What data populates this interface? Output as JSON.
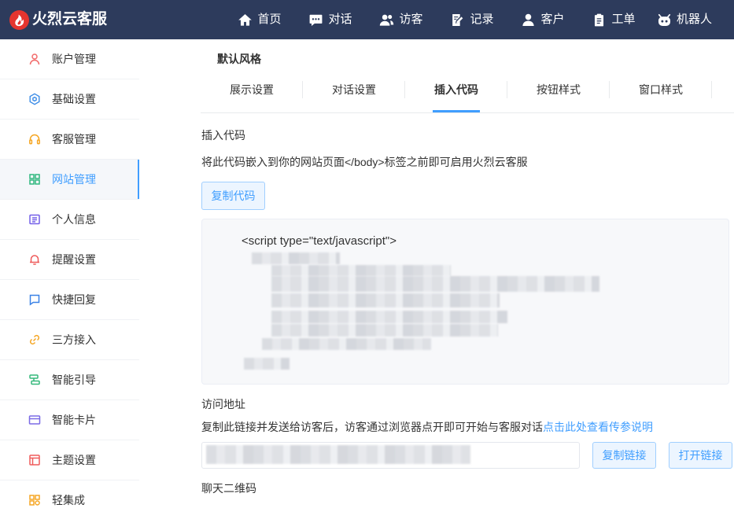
{
  "header": {
    "logo_text": "火烈云客服",
    "logo_icon": "flame-logo-icon",
    "nav": [
      {
        "label": "首页",
        "icon": "home-icon"
      },
      {
        "label": "对话",
        "icon": "chat-icon"
      },
      {
        "label": "访客",
        "icon": "visitors-icon"
      },
      {
        "label": "记录",
        "icon": "record-icon"
      },
      {
        "label": "客户",
        "icon": "customer-icon"
      },
      {
        "label": "工单",
        "icon": "ticket-icon"
      },
      {
        "label": "机器人",
        "icon": "robot-icon"
      }
    ]
  },
  "sidebar": {
    "items": [
      {
        "label": "账户管理",
        "icon": "user-icon",
        "color": "#f26b6b",
        "active": false
      },
      {
        "label": "基础设置",
        "icon": "hexagon-icon",
        "color": "#3c8ce7",
        "active": false
      },
      {
        "label": "客服管理",
        "icon": "headset-icon",
        "color": "#f5a623",
        "active": false
      },
      {
        "label": "网站管理",
        "icon": "grid-icon",
        "color": "#2fb77e",
        "active": true
      },
      {
        "label": "个人信息",
        "icon": "profile-doc-icon",
        "color": "#7460e8",
        "active": false
      },
      {
        "label": "提醒设置",
        "icon": "bell-icon",
        "color": "#ee5a5a",
        "active": false
      },
      {
        "label": "快捷回复",
        "icon": "message-icon",
        "color": "#3b82e6",
        "active": false
      },
      {
        "label": "三方接入",
        "icon": "link-icon",
        "color": "#f5a623",
        "active": false
      },
      {
        "label": "智能引导",
        "icon": "signpost-icon",
        "color": "#34b87a",
        "active": false
      },
      {
        "label": "智能卡片",
        "icon": "card-icon",
        "color": "#7b6be6",
        "active": false
      },
      {
        "label": "主题设置",
        "icon": "layout-icon",
        "color": "#ef5b5b",
        "active": false
      },
      {
        "label": "轻集成",
        "icon": "apps-icon",
        "color": "#f5a623",
        "active": false
      }
    ]
  },
  "main": {
    "style_label": "默认风格",
    "tabs": [
      {
        "label": "展示设置",
        "active": false
      },
      {
        "label": "对话设置",
        "active": false
      },
      {
        "label": "插入代码",
        "active": true
      },
      {
        "label": "按钮样式",
        "active": false
      },
      {
        "label": "窗口样式",
        "active": false
      }
    ],
    "insert_code": {
      "title": "插入代码",
      "description": "将此代码嵌入到你的网站页面</body>标签之前即可启用火烈云客服",
      "copy_button": "复制代码",
      "code_first_line": "<script type=\"text/javascript\">"
    },
    "access_url": {
      "title": "访问地址",
      "description": "复制此链接并发送给访客后，访客通过浏览器点开即可开始与客服对话",
      "help_link": "点击此处查看传参说明",
      "copy_button": "复制链接",
      "open_button": "打开链接"
    },
    "qr_code": {
      "title": "聊天二维码"
    }
  },
  "theme": {
    "header_bg": "#2d3b5c",
    "primary": "#409eff",
    "button_bg": "#ecf5ff"
  }
}
